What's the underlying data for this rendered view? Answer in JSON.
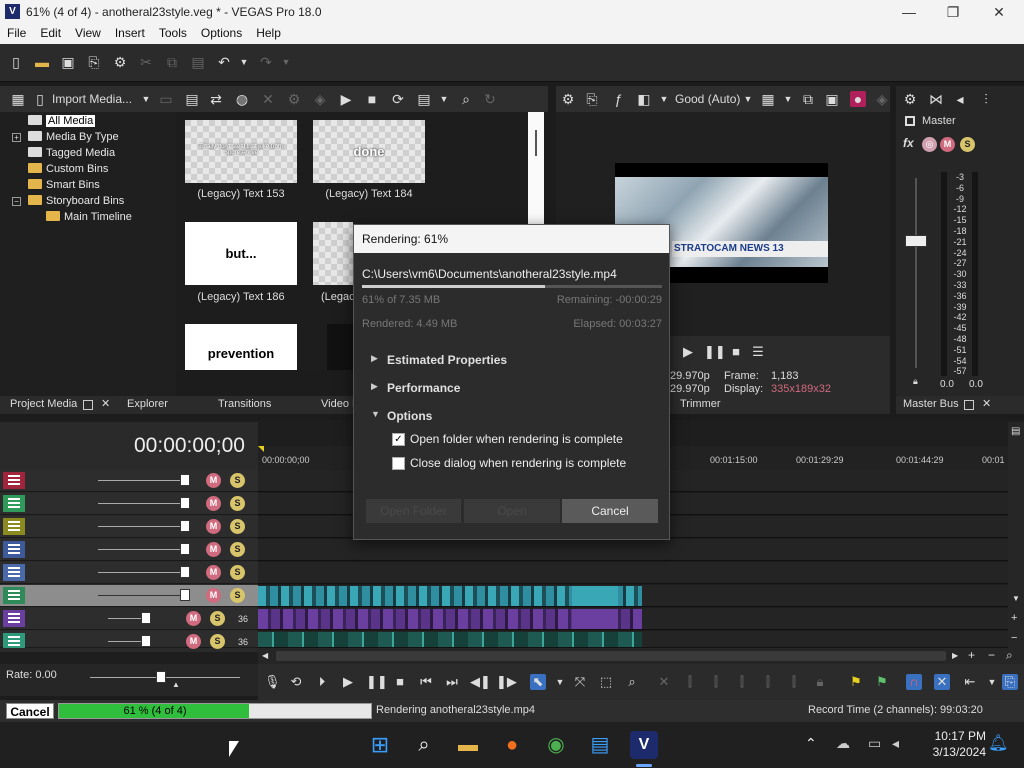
{
  "window": {
    "title": "61% (4 of 4) - anotheral23style.veg * - VEGAS Pro 18.0",
    "app_icon": "V",
    "minimize": "—",
    "maximize": "❐",
    "close": "✕"
  },
  "menu": [
    "File",
    "Edit",
    "View",
    "Insert",
    "Tools",
    "Options",
    "Help"
  ],
  "project_media": {
    "import_label": "Import Media...",
    "tree": [
      "All Media",
      "Media By Type",
      "Tagged Media",
      "Custom Bins",
      "Smart Bins",
      "Storyboard Bins",
      "Main Timeline"
    ],
    "items": [
      {
        "caption": "(Legacy) Text 153",
        "thumb_text": "Totally don't steal that joke from Spore Arkive"
      },
      {
        "caption": "(Legacy) Text 184",
        "thumb_text": "done"
      },
      {
        "caption": "(Legacy) Text 186",
        "thumb_text": "but..."
      },
      {
        "caption": "(Legac",
        "thumb_text": ""
      },
      {
        "caption": "",
        "thumb_text": "prevention"
      }
    ],
    "tabs": {
      "project_media": "Project Media",
      "explorer": "Explorer",
      "transitions": "Transitions",
      "video_fx": "Video F"
    }
  },
  "preview": {
    "quality": "Good (Auto)",
    "lower_third": "STRATOCAM NEWS 13",
    "fps1": "29.970p",
    "fps2": "29.970p",
    "frame_label": "Frame:",
    "frame_value": "1,183",
    "display_label": "Display:",
    "display_value": "335x189x32",
    "tab_trimmer": "Trimmer"
  },
  "master_bus": {
    "label": "Master",
    "scale": [
      "3",
      "6",
      "9",
      "12",
      "15",
      "18",
      "21",
      "24",
      "27",
      "30",
      "33",
      "36",
      "39",
      "42",
      "45",
      "48",
      "51",
      "54",
      "57"
    ],
    "level_left": "0.0",
    "level_right": "0.0",
    "tab": "Master Bus"
  },
  "timeline": {
    "timecode": "00:00:00;00",
    "ruler": [
      "00:00:00;00",
      "00:01:15:00",
      "00:01:29:29",
      "00:01:44:29",
      "00:01"
    ],
    "rate_label": "Rate: 0.00",
    "track_levels": [
      "36",
      "36"
    ]
  },
  "render_dialog": {
    "title": "Rendering: 61%",
    "path": "C:\\Users\\vm6\\Documents\\anotheral23style.mp4",
    "progress": 0.61,
    "size_done": "61% of 7.35 MB",
    "remaining": "Remaining: -00:00:29",
    "rendered": "Rendered: 4.49 MB",
    "elapsed": "Elapsed: 00:03:27",
    "sections": [
      "Estimated Properties",
      "Performance",
      "Options"
    ],
    "opt_open_folder": "Open folder when rendering is complete",
    "opt_close_dialog": "Close dialog when rendering is complete",
    "btn_open_folder": "Open Folder",
    "btn_open": "Open",
    "btn_cancel": "Cancel"
  },
  "status": {
    "cancel": "Cancel",
    "progress_text": "61 % (4 of 4)",
    "progress": 0.61,
    "message": "Rendering anotheral23style.mp4",
    "record_time": "Record Time (2 channels): 99:03:20"
  },
  "taskbar": {
    "time": "10:17 PM",
    "date": "3/13/2024"
  },
  "colors": {
    "accent": "#2fbf3c",
    "clip_teal": "#3aa7b7",
    "clip_purple": "#6a3fa0"
  }
}
